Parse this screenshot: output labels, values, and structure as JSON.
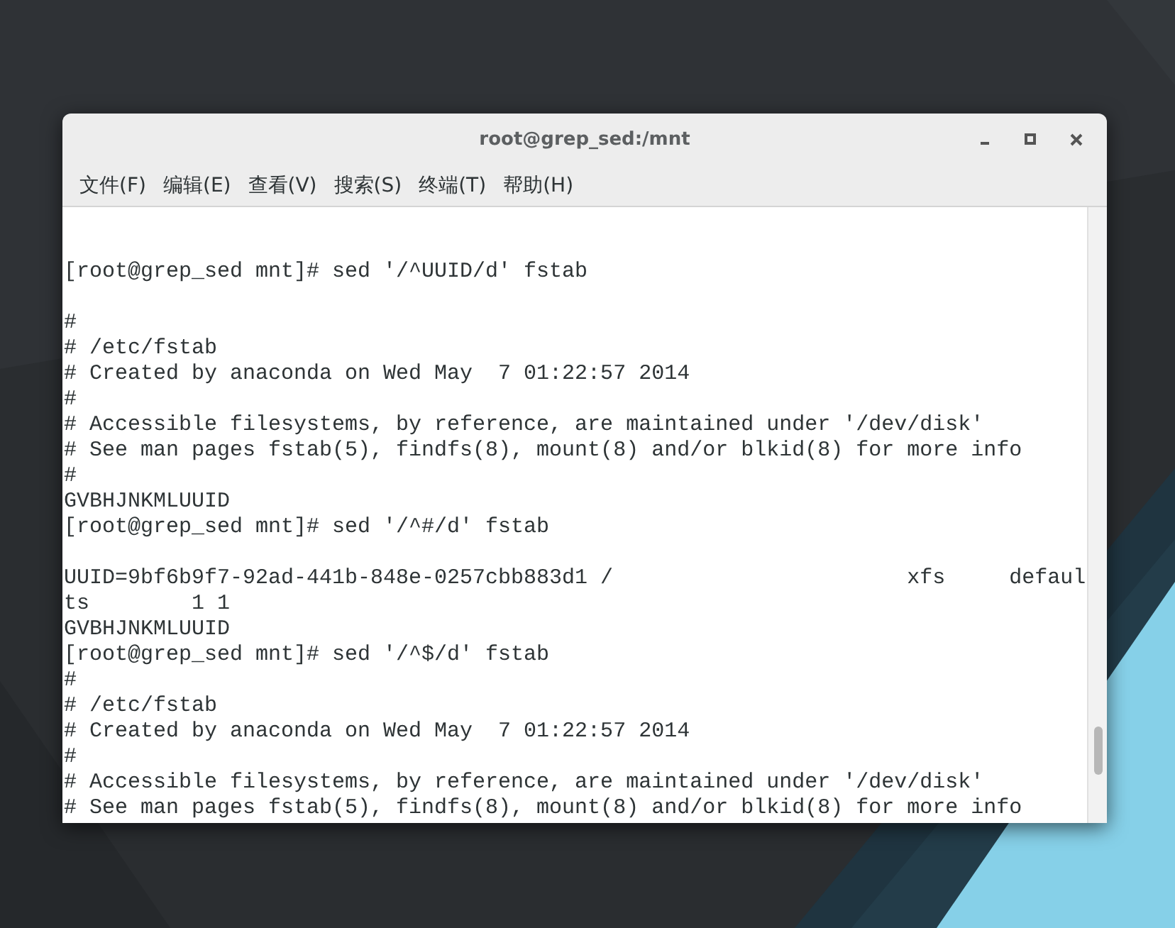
{
  "window": {
    "title": "root@grep_sed:/mnt"
  },
  "menu": [
    {
      "label": "文件(F)"
    },
    {
      "label": "编辑(E)"
    },
    {
      "label": "查看(V)"
    },
    {
      "label": "搜索(S)"
    },
    {
      "label": "终端(T)"
    },
    {
      "label": "帮助(H)"
    }
  ],
  "terminal": {
    "lines": [
      {
        "kind": "blank"
      },
      {
        "kind": "blank"
      },
      {
        "kind": "prompt",
        "text": "[root@grep_sed mnt]# sed '/^UUID/d' fstab"
      },
      {
        "kind": "blank"
      },
      {
        "kind": "output",
        "text": "#"
      },
      {
        "kind": "output",
        "text": "# /etc/fstab"
      },
      {
        "kind": "output",
        "text": "# Created by anaconda on Wed May  7 01:22:57 2014"
      },
      {
        "kind": "output",
        "text": "#"
      },
      {
        "kind": "output",
        "text": "# Accessible filesystems, by reference, are maintained under '/dev/disk'"
      },
      {
        "kind": "output",
        "text": "# See man pages fstab(5), findfs(8), mount(8) and/or blkid(8) for more info"
      },
      {
        "kind": "output",
        "text": "#"
      },
      {
        "kind": "output",
        "text": "GVBHJNKMLUUID"
      },
      {
        "kind": "prompt",
        "text": "[root@grep_sed mnt]# sed '/^#/d' fstab"
      },
      {
        "kind": "blank"
      },
      {
        "kind": "output",
        "text": "UUID=9bf6b9f7-92ad-441b-848e-0257cbb883d1 /                       xfs     defaul"
      },
      {
        "kind": "output",
        "text": "ts        1 1"
      },
      {
        "kind": "output",
        "text": "GVBHJNKMLUUID"
      },
      {
        "kind": "prompt",
        "text": "[root@grep_sed mnt]# sed '/^$/d' fstab"
      },
      {
        "kind": "output",
        "text": "#"
      },
      {
        "kind": "output",
        "text": "# /etc/fstab"
      },
      {
        "kind": "output",
        "text": "# Created by anaconda on Wed May  7 01:22:57 2014"
      },
      {
        "kind": "output",
        "text": "#"
      },
      {
        "kind": "output",
        "text": "# Accessible filesystems, by reference, are maintained under '/dev/disk'"
      },
      {
        "kind": "output",
        "text": "# See man pages fstab(5), findfs(8), mount(8) and/or blkid(8) for more info"
      }
    ]
  }
}
